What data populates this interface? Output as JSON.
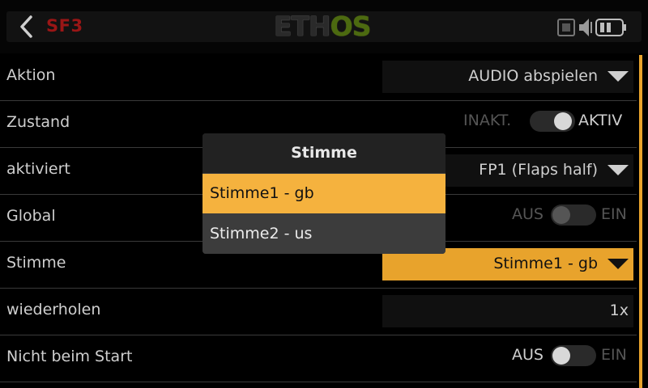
{
  "header": {
    "model_name": "SF3",
    "logo_part1": "ETH",
    "logo_part2": "OS",
    "icons": [
      "back-arrow-icon",
      "screen-icon",
      "speaker-icon",
      "battery-icon"
    ]
  },
  "rows": [
    {
      "label": "Aktion",
      "value": "AUDIO abspielen"
    },
    {
      "label": "Zustand",
      "off": "INAKT.",
      "on": "AKTIV"
    },
    {
      "label": "aktiviert",
      "value": "FP1 (Flaps half)"
    },
    {
      "label": "Global",
      "off": "AUS",
      "on": "EIN"
    },
    {
      "label": "Stimme",
      "value": "Stimme1 - gb"
    },
    {
      "label": "wiederholen",
      "value": "1x"
    },
    {
      "label": "Nicht beim Start",
      "off": "AUS",
      "on": "EIN"
    }
  ],
  "popup": {
    "title": "Stimme",
    "options": [
      "Stimme1 - gb",
      "Stimme2 - us"
    ],
    "selected": "Stimme1 - gb"
  },
  "colors": {
    "accent": "#f5b23e",
    "model_name": "#9a1616",
    "logo_green": "#8db21f",
    "background": "#000000"
  }
}
